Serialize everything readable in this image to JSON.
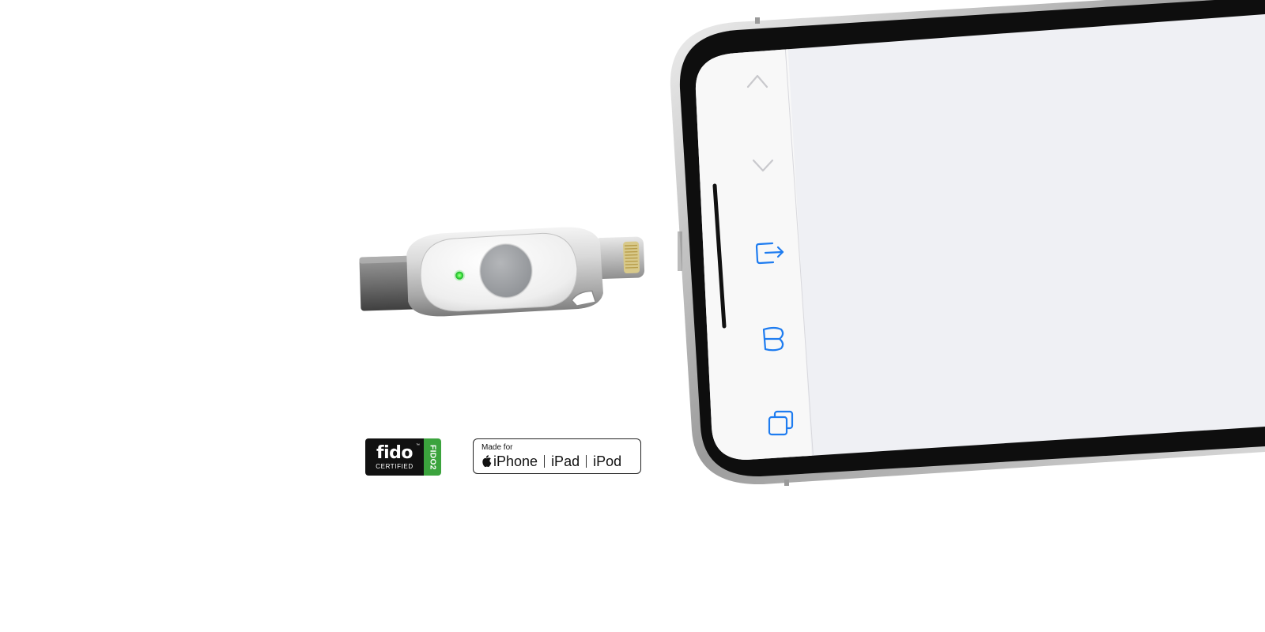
{
  "fido_badge": {
    "word": "fido",
    "trademark": "™",
    "certified": "CERTIFIED",
    "side_label": "FIDO2"
  },
  "mfi_badge": {
    "made_for": "Made for",
    "devices": [
      "iPhone",
      "iPad",
      "iPod"
    ]
  },
  "phone_toolbar": {
    "items": [
      "chevron-up-icon",
      "chevron-down-icon",
      "share-icon",
      "bookmarks-icon",
      "tabs-icon"
    ]
  },
  "colors": {
    "background": "#ffffff",
    "led_green": "#39e43a",
    "phone_toolbar_icon_blue": "#1e7cf0",
    "phone_screen": "#eff0f4",
    "fido_green": "#3ba33d"
  }
}
